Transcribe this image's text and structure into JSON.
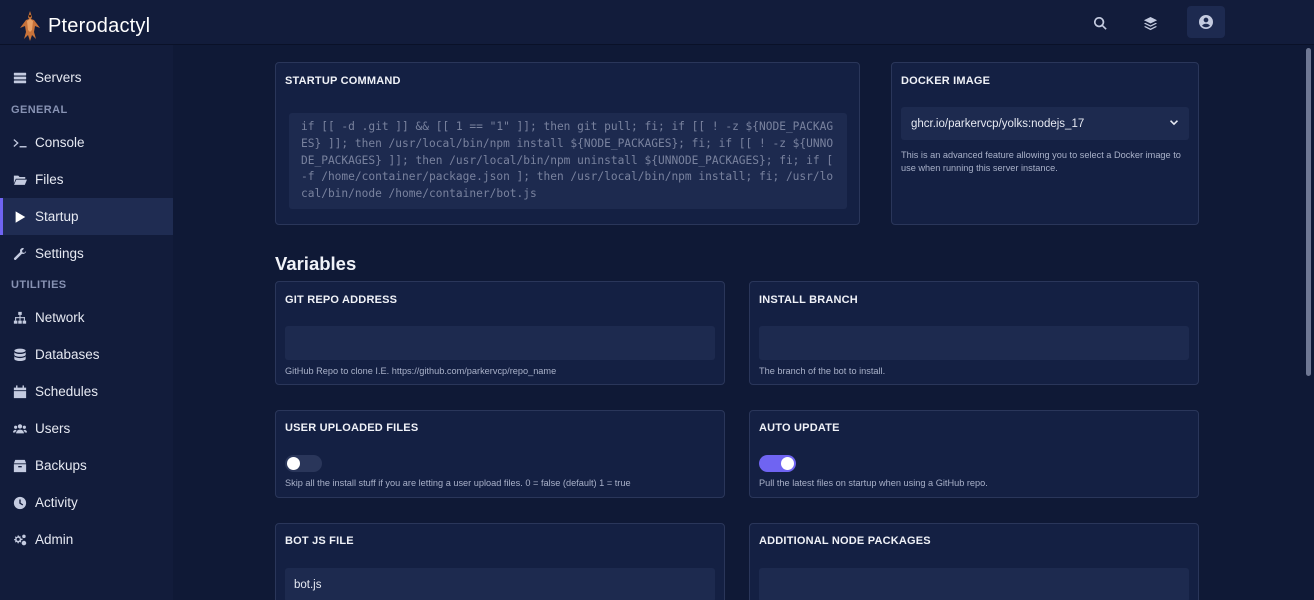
{
  "app": {
    "name": "Pterodactyl"
  },
  "topbar": {
    "icons": [
      "search-icon",
      "layers-icon",
      "account-icon"
    ]
  },
  "sidebar": {
    "servers_label": "Servers",
    "general_heading": "GENERAL",
    "utilities_heading": "UTILITIES",
    "items": [
      {
        "label": "Console",
        "icon": "terminal-icon"
      },
      {
        "label": "Files",
        "icon": "folder-icon"
      },
      {
        "label": "Startup",
        "icon": "play-icon",
        "active": true
      },
      {
        "label": "Settings",
        "icon": "wrench-icon"
      },
      {
        "label": "Network",
        "icon": "network-icon"
      },
      {
        "label": "Databases",
        "icon": "database-icon"
      },
      {
        "label": "Schedules",
        "icon": "calendar-icon"
      },
      {
        "label": "Users",
        "icon": "users-icon"
      },
      {
        "label": "Backups",
        "icon": "archive-icon"
      },
      {
        "label": "Activity",
        "icon": "clock-icon"
      },
      {
        "label": "Admin",
        "icon": "cogs-icon"
      }
    ]
  },
  "startup": {
    "title": "STARTUP COMMAND",
    "command": "if [[ -d .git ]] && [[ 1 == \"1\" ]]; then git pull; fi; if [[ ! -z ${NODE_PACKAGES} ]]; then /usr/local/bin/npm install ${NODE_PACKAGES}; fi; if [[ ! -z ${UNNODE_PACKAGES} ]]; then /usr/local/bin/npm uninstall ${UNNODE_PACKAGES}; fi; if [ -f /home/container/package.json ]; then /usr/local/bin/npm install; fi; /usr/local/bin/node /home/container/bot.js"
  },
  "docker": {
    "title": "DOCKER IMAGE",
    "selected": "ghcr.io/parkervcp/yolks:nodejs_17",
    "description": "This is an advanced feature allowing you to select a Docker image to use when running this server instance."
  },
  "variables": {
    "heading": "Variables",
    "git_repo": {
      "title": "GIT REPO ADDRESS",
      "value": "",
      "description": "GitHub Repo to clone I.E. https://github.com/parkervcp/repo_name"
    },
    "install_branch": {
      "title": "INSTALL BRANCH",
      "value": "",
      "description": "The branch of the bot to install."
    },
    "user_uploaded": {
      "title": "USER UPLOADED FILES",
      "enabled": false,
      "description": "Skip all the install stuff if you are letting a user upload files. 0 = false (default) 1 = true"
    },
    "auto_update": {
      "title": "AUTO UPDATE",
      "enabled": true,
      "description": "Pull the latest files on startup when using a GitHub repo."
    },
    "bot_js_file": {
      "title": "BOT JS FILE",
      "value": "bot.js"
    },
    "additional_packages": {
      "title": "ADDITIONAL NODE PACKAGES",
      "value": ""
    }
  },
  "colors": {
    "background": "#0f1936",
    "panel": "#142043",
    "accent": "#6f64f2"
  }
}
